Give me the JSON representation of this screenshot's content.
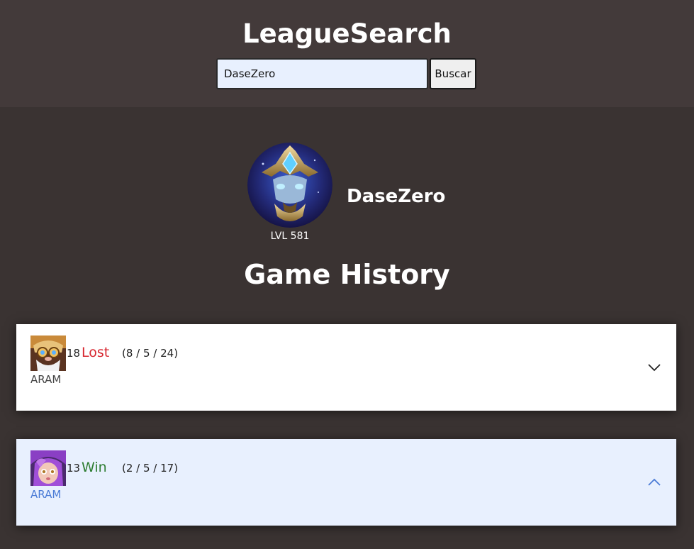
{
  "header": {
    "title": "LeagueSearch",
    "search_value": "DaseZero",
    "search_button": "Buscar"
  },
  "profile": {
    "icon": "summoner-profile-icon",
    "name": "DaseZero",
    "level": "LVL 581"
  },
  "history": {
    "title": "Game History",
    "matches": [
      {
        "champion_icon": "heimerdinger-icon",
        "champion_level": "18",
        "result": "Lost",
        "kda": "(8 / 5 / 24)",
        "mode": "ARAM",
        "expanded": false
      },
      {
        "champion_icon": "neeko-icon",
        "champion_level": "13",
        "result": "Win",
        "kda": "(2 / 5 / 17)",
        "mode": "ARAM",
        "expanded": true
      }
    ]
  },
  "colors": {
    "header_bg": "#433a3a",
    "page_bg": "#3a3332",
    "lost": "#d7262f",
    "win": "#2e7d32",
    "expanded_bg": "#e8f0fe",
    "accent": "#4a7bd6"
  }
}
